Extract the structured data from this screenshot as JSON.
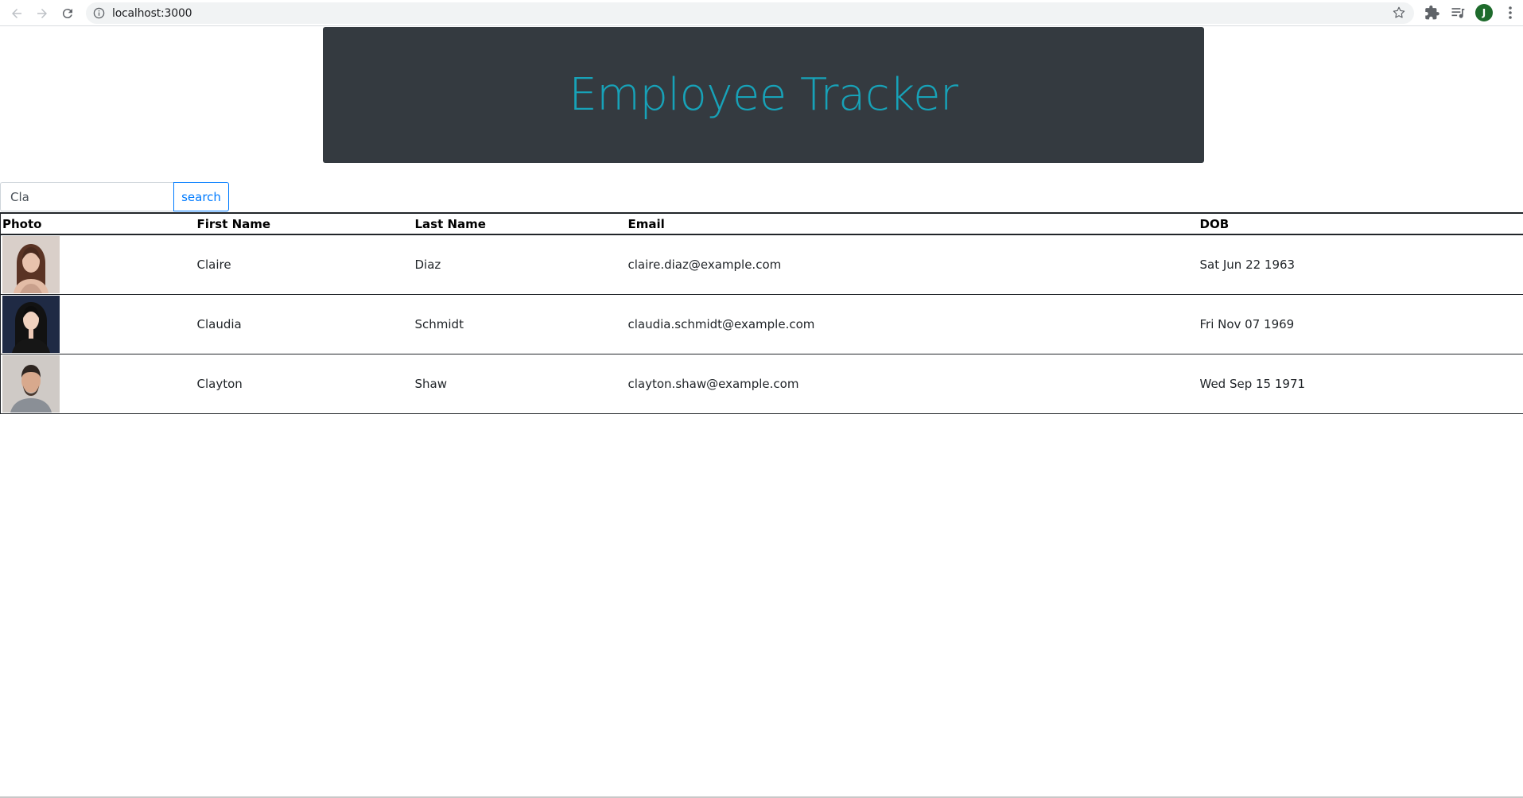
{
  "browser": {
    "url": "localhost:3000",
    "profile_initial": "J"
  },
  "header": {
    "title": "Employee Tracker"
  },
  "search": {
    "value": "Cla",
    "button_label": "search"
  },
  "table": {
    "columns": [
      "Photo",
      "First Name",
      "Last Name",
      "Email",
      "DOB"
    ],
    "rows": [
      {
        "photo": "woman-portrait-1",
        "first": "Claire",
        "last": "Diaz",
        "email": "claire.diaz@example.com",
        "dob": "Sat Jun 22 1963"
      },
      {
        "photo": "woman-portrait-2",
        "first": "Claudia",
        "last": "Schmidt",
        "email": "claudia.schmidt@example.com",
        "dob": "Fri Nov 07 1969"
      },
      {
        "photo": "man-portrait-1",
        "first": "Clayton",
        "last": "Shaw",
        "email": "clayton.shaw@example.com",
        "dob": "Wed Sep 15 1971"
      }
    ]
  },
  "colors": {
    "header_bg": "#343a40",
    "header_text": "#17a2b8",
    "button_accent": "#007bff"
  }
}
